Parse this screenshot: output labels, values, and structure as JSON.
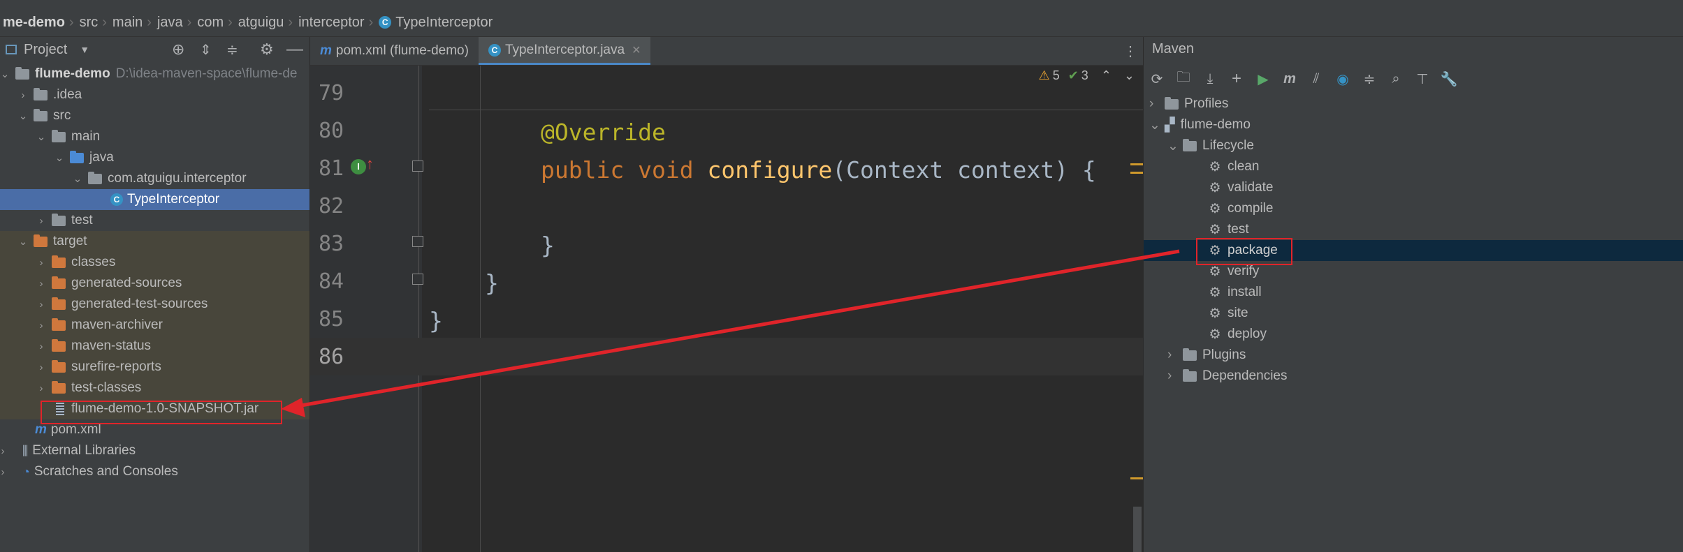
{
  "breadcrumb": {
    "items": [
      "me-demo",
      "src",
      "main",
      "java",
      "com",
      "atguigu",
      "interceptor"
    ],
    "current": "TypeInterceptor"
  },
  "project_panel": {
    "title": "Project",
    "tree": [
      {
        "label": "flume-demo",
        "path": "D:\\idea-maven-space\\flume-de"
      },
      {
        "label": ".idea"
      },
      {
        "label": "src"
      },
      {
        "label": "main"
      },
      {
        "label": "java"
      },
      {
        "label": "com.atguigu.interceptor"
      },
      {
        "label": "TypeInterceptor"
      },
      {
        "label": "test"
      },
      {
        "label": "target"
      },
      {
        "label": "classes"
      },
      {
        "label": "generated-sources"
      },
      {
        "label": "generated-test-sources"
      },
      {
        "label": "maven-archiver"
      },
      {
        "label": "maven-status"
      },
      {
        "label": "surefire-reports"
      },
      {
        "label": "test-classes"
      },
      {
        "label": "flume-demo-1.0-SNAPSHOT.jar"
      },
      {
        "label": "pom.xml"
      },
      {
        "label": "External Libraries"
      },
      {
        "label": "Scratches and Consoles"
      }
    ]
  },
  "editor": {
    "tabs": [
      {
        "label": "pom.xml (flume-demo)"
      },
      {
        "label": "TypeInterceptor.java"
      }
    ],
    "warnings": "5",
    "checks": "3",
    "line_numbers": [
      "79",
      "80",
      "81",
      "82",
      "83",
      "84",
      "85",
      "86"
    ],
    "code": {
      "l80_annotation": "@Override",
      "l81_public": "public",
      "l81_void": "void",
      "l81_method": "configure",
      "l81_params": "(Context context) {",
      "l83": "}",
      "l84": "}",
      "l85": "}"
    }
  },
  "maven_panel": {
    "title": "Maven",
    "profiles": "Profiles",
    "project": "flume-demo",
    "lifecycle": "Lifecycle",
    "phases": [
      "clean",
      "validate",
      "compile",
      "test",
      "package",
      "verify",
      "install",
      "site",
      "deploy"
    ],
    "plugins": "Plugins",
    "dependencies": "Dependencies"
  }
}
